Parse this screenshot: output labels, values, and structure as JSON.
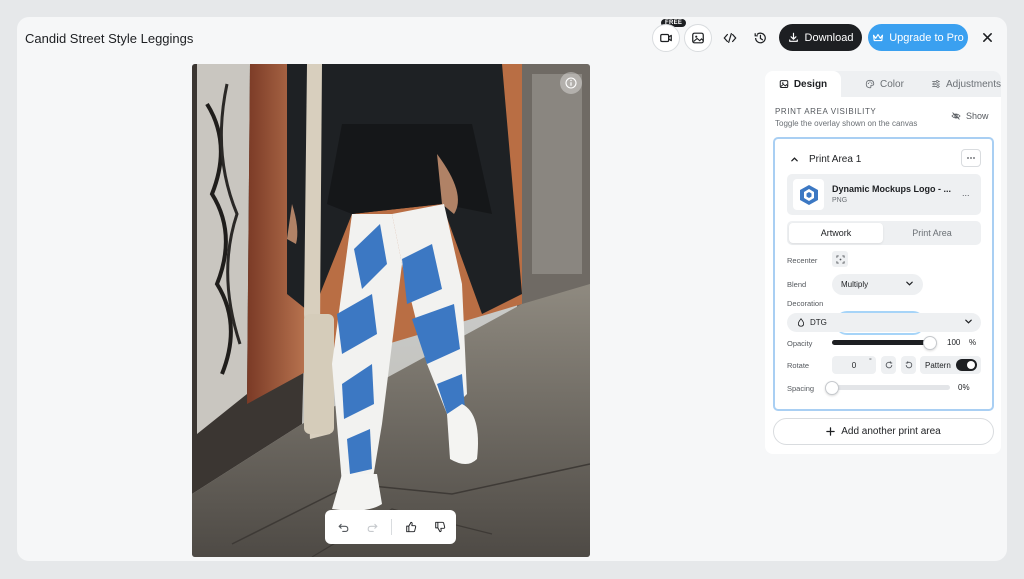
{
  "header": {
    "title": "Candid Street Style Leggings",
    "free_badge": "FREE",
    "download_label": "Download",
    "upgrade_label": "Upgrade to Pro"
  },
  "panel": {
    "tabs": [
      {
        "label": "Design",
        "icon": "image-icon",
        "active": true
      },
      {
        "label": "Color",
        "icon": "palette-icon",
        "active": false
      },
      {
        "label": "Adjustments",
        "icon": "sliders-icon",
        "active": false
      }
    ],
    "visibility": {
      "title": "PRINT AREA VISIBILITY",
      "subtitle": "Toggle the overlay shown on the canvas",
      "show_label": "Show"
    },
    "print_area": {
      "name": "Print Area 1",
      "file_name": "Dynamic Mockups Logo - ...",
      "file_type": "PNG",
      "file_menu": "...",
      "segments": [
        "Artwork",
        "Print Area"
      ],
      "active_segment": "Artwork",
      "recenter_label": "Recenter",
      "blend_label": "Blend",
      "blend_value": "Multiply",
      "decoration_label": "Decoration",
      "decoration_value": "DTG",
      "opacity_label": "Opacity",
      "opacity_value": "100",
      "opacity_unit": "%",
      "opacity_fraction": 1.0,
      "rotate_label": "Rotate",
      "rotate_value": "0",
      "rotate_unit": "°",
      "pattern_label": "Pattern",
      "pattern_on": true,
      "spacing_label": "Spacing",
      "spacing_value": "0%",
      "spacing_fraction": 0.0
    },
    "add_label": "Add another print area"
  },
  "colors": {
    "accent": "#3aa0f0",
    "dark": "#1d1f22",
    "selection_border": "#a9cff3",
    "legging_blue": "#3c78c3"
  }
}
